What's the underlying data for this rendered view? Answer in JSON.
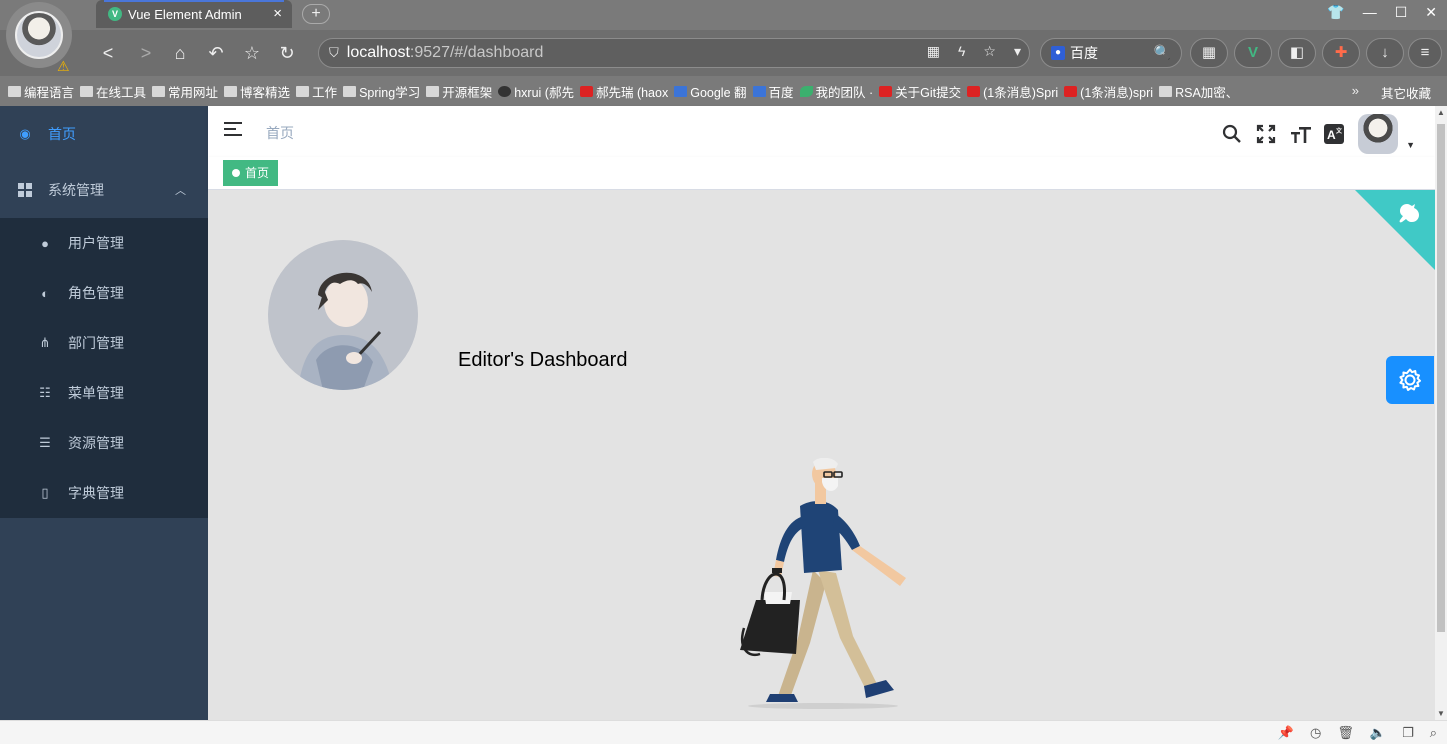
{
  "browser": {
    "tab_title": "Vue Element Admin",
    "tab_close": "×",
    "new_tab": "+",
    "address_host": "localhost",
    "address_rest": ":9527/#/dashboard",
    "search_engine": "百度",
    "bookmarks": [
      {
        "label": "编程语言",
        "icon": "folder"
      },
      {
        "label": "在线工具",
        "icon": "folder"
      },
      {
        "label": "常用网址",
        "icon": "folder"
      },
      {
        "label": "博客精选",
        "icon": "folder"
      },
      {
        "label": "工作",
        "icon": "folder"
      },
      {
        "label": "Spring学习",
        "icon": "folder"
      },
      {
        "label": "开源框架",
        "icon": "folder"
      },
      {
        "label": "hxrui (郝先",
        "icon": "github"
      },
      {
        "label": "郝先瑞 (haox",
        "icon": "gitee"
      },
      {
        "label": "Google 翻",
        "icon": "google-translate"
      },
      {
        "label": "百度",
        "icon": "baidu"
      },
      {
        "label": "我的团队 ·",
        "icon": "team"
      },
      {
        "label": "关于Git提交",
        "icon": "code"
      },
      {
        "label": "(1条消息)Spri",
        "icon": "csdn"
      },
      {
        "label": "(1条消息)spri",
        "icon": "csdn"
      },
      {
        "label": "RSA加密、",
        "icon": "page"
      }
    ],
    "more": "»",
    "other_bookmarks": "其它收藏"
  },
  "sidebar": {
    "home": "首页",
    "system": "系统管理",
    "items": [
      {
        "label": "用户管理",
        "icon": "user-icon",
        "glyph": "👤"
      },
      {
        "label": "角色管理",
        "icon": "role-icon",
        "glyph": "👥"
      },
      {
        "label": "部门管理",
        "icon": "tree-icon",
        "glyph": "⊥"
      },
      {
        "label": "菜单管理",
        "icon": "menu-tree-icon",
        "glyph": "☰"
      },
      {
        "label": "资源管理",
        "icon": "list-icon",
        "glyph": "≡"
      },
      {
        "label": "字典管理",
        "icon": "book-icon",
        "glyph": "▯"
      }
    ]
  },
  "header": {
    "breadcrumb": "首页",
    "tools": [
      "search-icon",
      "fullscreen-icon",
      "size-icon",
      "language-icon"
    ]
  },
  "tags": {
    "active_tag": "首页"
  },
  "dashboard": {
    "title": "Editor's Dashboard"
  },
  "colors": {
    "sidebar_bg": "#304156",
    "submenu_bg": "#1f2d3d",
    "active": "#409eff",
    "tag_green": "#42b983",
    "corner": "#40c9c6",
    "settings": "#1890ff"
  }
}
